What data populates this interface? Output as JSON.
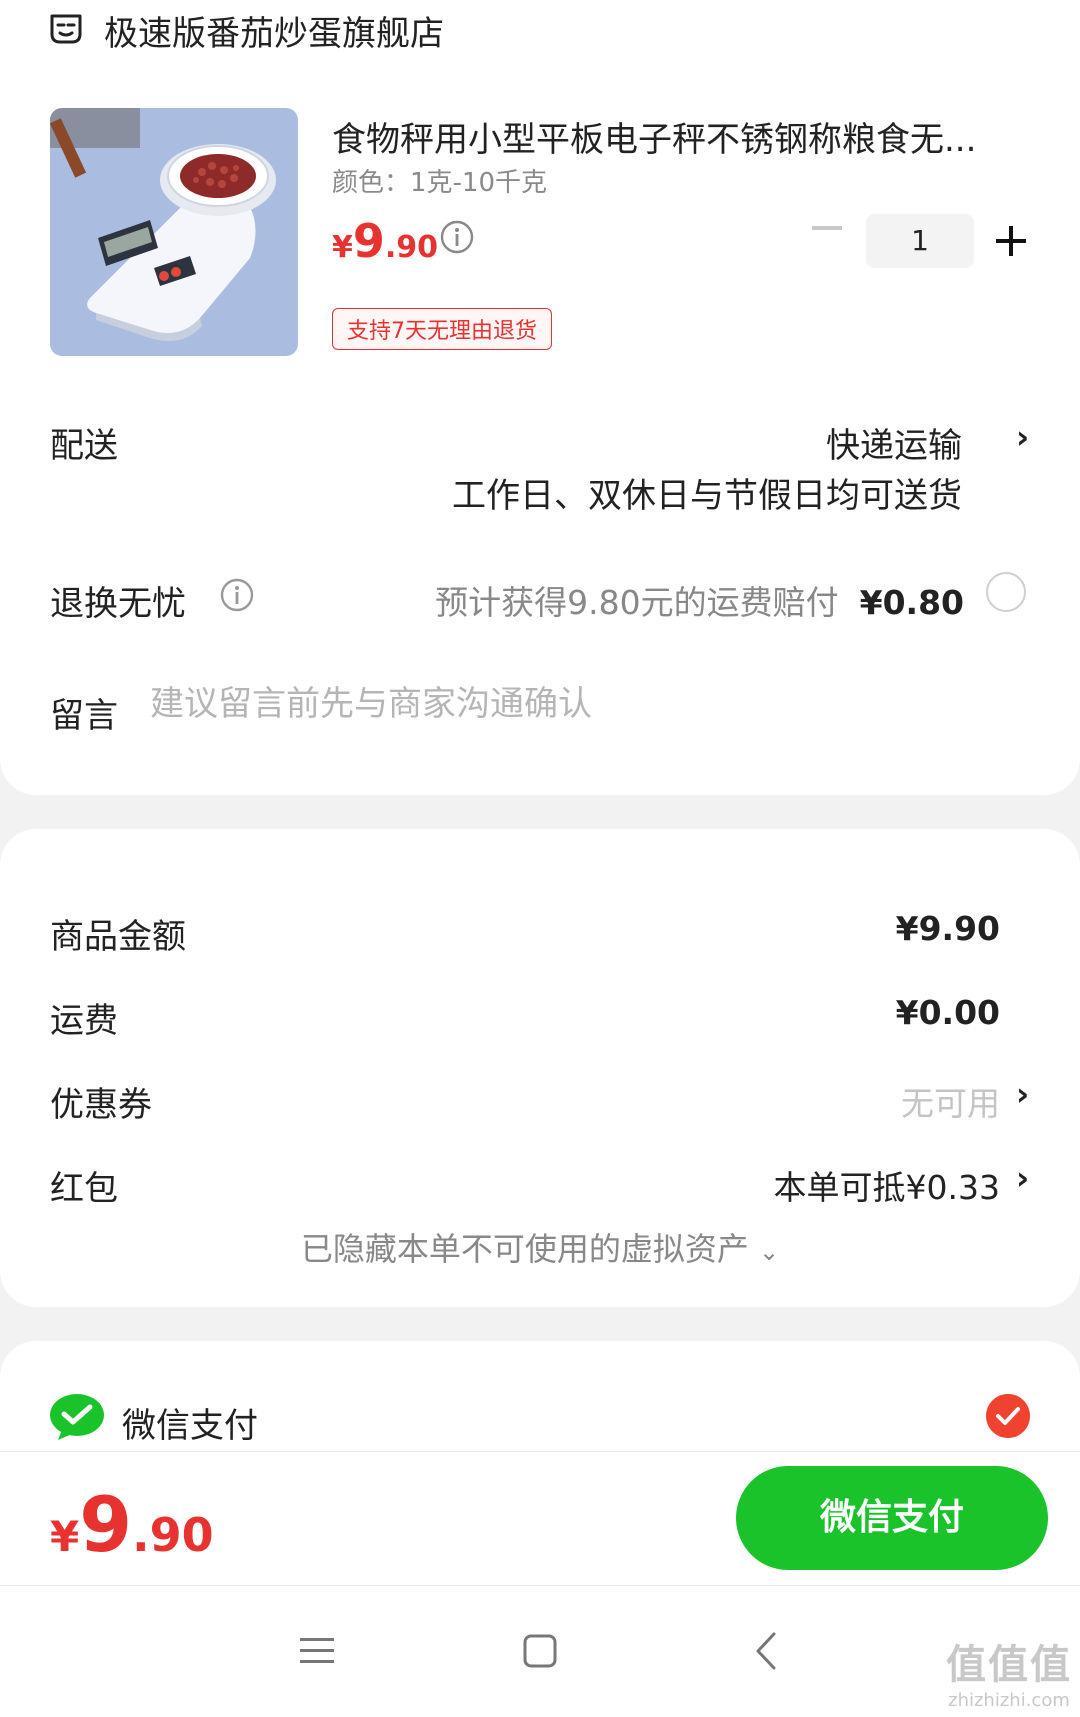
{
  "store": {
    "name": "极速版番茄炒蛋旗舰店",
    "icon": "store-icon"
  },
  "product": {
    "title": "食物秤用小型平板电子秤不锈钢称粮食无...",
    "spec": "颜色：1克-10千克",
    "price_currency": "¥",
    "price_int": "9",
    "price_dec": ".90",
    "quantity": "1",
    "return_badge": "支持7天无理由退货"
  },
  "delivery": {
    "label": "配送",
    "method": "快递运输",
    "note": "工作日、双休日与节假日均可送货"
  },
  "return_insurance": {
    "label": "退换无忧",
    "desc": "预计获得9.80元的运费赔付",
    "price": "¥0.80",
    "selected": false
  },
  "message": {
    "label": "留言",
    "placeholder": "建议留言前先与商家沟通确认"
  },
  "summary": {
    "goods_label": "商品金额",
    "goods_value": "¥9.90",
    "shipping_label": "运费",
    "shipping_value": "¥0.00",
    "coupon_label": "优惠券",
    "coupon_value": "无可用",
    "redpacket_label": "红包",
    "redpacket_value": "本单可抵¥0.33",
    "hidden_assets": "已隐藏本单不可使用的虚拟资产"
  },
  "payment": {
    "method_label": "微信支付",
    "selected": true
  },
  "bottom_bar": {
    "currency": "¥",
    "total_int": "9",
    "total_dec": ".90",
    "pay_button": "微信支付"
  },
  "watermark": {
    "line1": "值值值",
    "line2": "zhizhizhi.com"
  },
  "colors": {
    "accent_red": "#e8322f",
    "wechat_green": "#1bc32b",
    "background": "#f2f2f2"
  }
}
